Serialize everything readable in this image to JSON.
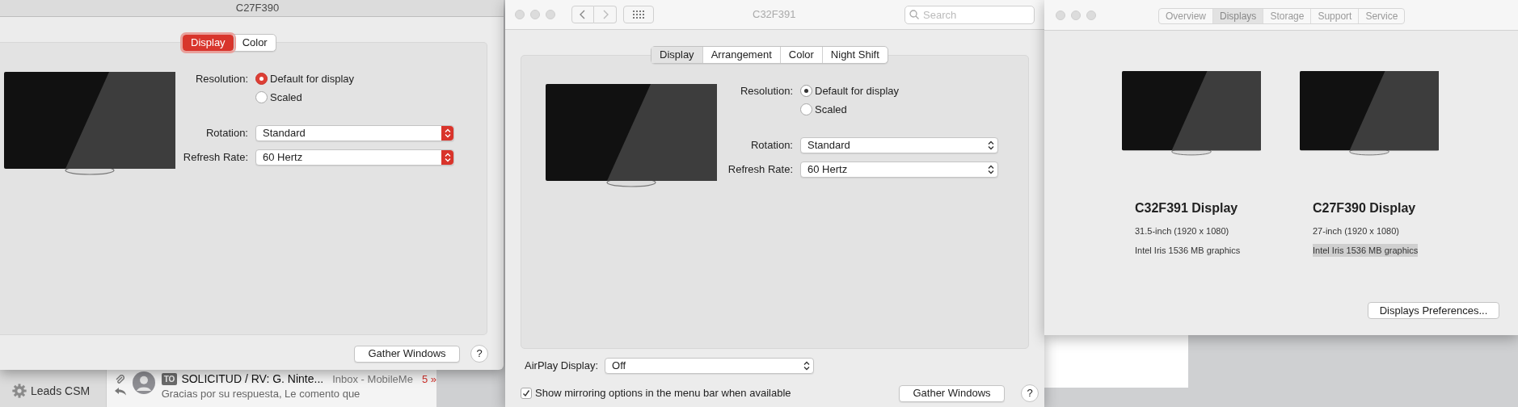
{
  "mail_window": {
    "sidebar_items": [
      {
        "label": "Leads CSM"
      }
    ],
    "message": {
      "tag": "TO",
      "subject": "SOLICITUD / RV: G. Ninte...",
      "mailbox": "Inbox - MobileMe",
      "count": "5 »",
      "preview_lines": [
        "Gracias por su respuesta, Le comento que"
      ]
    }
  },
  "display_window_1": {
    "title": "C27F390",
    "active": true,
    "tabs": [
      {
        "label": "Display",
        "selected": true
      },
      {
        "label": "Color",
        "selected": false
      }
    ],
    "resolution_label": "Resolution:",
    "resolution_options": [
      {
        "label": "Default for display",
        "selected": true
      },
      {
        "label": "Scaled",
        "selected": false
      }
    ],
    "rotation": {
      "label": "Rotation:",
      "value": "Standard"
    },
    "refresh_rate": {
      "label": "Refresh Rate:",
      "value": "60 Hertz"
    },
    "gather_button": "Gather Windows",
    "help_button": "?"
  },
  "display_window_2": {
    "title": "C32F391",
    "active": false,
    "search": {
      "placeholder": "Search"
    },
    "tabs": [
      {
        "label": "Display",
        "selected": true
      },
      {
        "label": "Arrangement",
        "selected": false
      },
      {
        "label": "Color",
        "selected": false
      },
      {
        "label": "Night Shift",
        "selected": false
      }
    ],
    "resolution_label": "Resolution:",
    "resolution_options": [
      {
        "label": "Default for display",
        "selected": true
      },
      {
        "label": "Scaled",
        "selected": false
      }
    ],
    "rotation": {
      "label": "Rotation:",
      "value": "Standard"
    },
    "refresh_rate": {
      "label": "Refresh Rate:",
      "value": "60 Hertz"
    },
    "airplay": {
      "label": "AirPlay Display:",
      "value": "Off"
    },
    "mirroring": {
      "label": "Show mirroring options in the menu bar when available",
      "checked": true
    },
    "gather_button": "Gather Windows",
    "help_button": "?"
  },
  "about_window": {
    "tabs": [
      {
        "label": "Overview",
        "selected": false
      },
      {
        "label": "Displays",
        "selected": true
      },
      {
        "label": "Storage",
        "selected": false
      },
      {
        "label": "Support",
        "selected": false
      },
      {
        "label": "Service",
        "selected": false
      }
    ],
    "displays": [
      {
        "name": "C32F391 Display",
        "size": "31.5-inch (1920 x 1080)",
        "graphics": "Intel Iris 1536 MB graphics",
        "highlighted": false
      },
      {
        "name": "C27F390 Display",
        "size": "27-inch (1920 x 1080)",
        "graphics": "Intel Iris 1536 MB graphics",
        "highlighted": true
      }
    ],
    "button": "Displays Preferences..."
  }
}
